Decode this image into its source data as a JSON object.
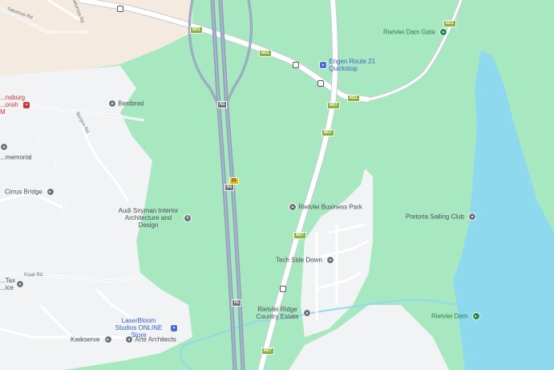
{
  "map": {
    "pois": {
      "rietvlei_dam_gate": "Rietvlei Dam Gate",
      "engen_route21": "Engen Route 21 Quickstop",
      "bestbred": "Bestbred",
      "cirrus_bridge": "Cirrus Bridge",
      "audi_snyman": "Audi Snyman Interior Architecture and Design",
      "rietvlei_business_park": "Rietvlei Business Park",
      "pretoria_sailing_club": "Pretoria Sailing Club",
      "tech_side_down": "Tech Side Down",
      "rietvlei_ridge": "Rietvlei Ridge Country Estate",
      "rietvlei_dam": "Rietvlei Dam",
      "laserbloom": "LaserBloom Studios ONLINE Store",
      "arte_architects": "Arte Architects",
      "kwikserve": "Kwikserve",
      "partial_red": "...nsburg ...orah M",
      "partial_memorial": "...memorial",
      "partial_tax": "...Tax ...ice"
    },
    "streets": {
      "saturnus_1": "Saturnus Rd",
      "saturnus_2": "Saturnus Rd",
      "bergen_rd": "Bergen Rd",
      "kiaat_rd": "Kiaat Rd"
    },
    "shields": {
      "m31_a": "M31",
      "m31_b": "M31",
      "m31_c": "M31",
      "m31_d": "M31",
      "m57_a": "M57",
      "m57_b": "M57",
      "m57_c": "M57",
      "m57_d": "M57",
      "n1_a": "N1",
      "n1_b": "N1",
      "n1_c": "N1",
      "r21": "21"
    },
    "colors": {
      "park_green": "#a8e8c0",
      "urban_grey": "#f1f3f4",
      "sand": "#f4eadf",
      "water": "#8fd9ef",
      "highway": "#8a9bb4",
      "arterial": "#c4ccd4"
    }
  }
}
